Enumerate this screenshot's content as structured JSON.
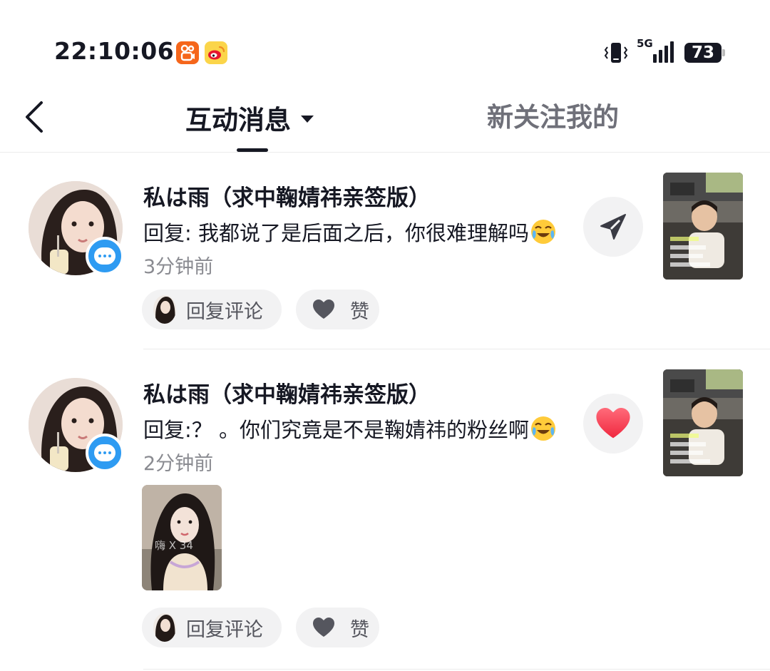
{
  "status_bar": {
    "time": "22:10:06",
    "network": "5G",
    "battery": "73",
    "app_icons": [
      "kuaishou-app-icon",
      "weibo-app-icon"
    ]
  },
  "nav": {
    "back_icon": "chevron-left-icon",
    "active_tab": "互动消息",
    "inactive_tab": "新关注我的"
  },
  "notifications": [
    {
      "username": "私は雨（求中鞠婧祎亲签版）",
      "comment": "回复: 我都说了是后面之后，你很难理解吗",
      "emoji": "crying-laughing-emoji",
      "time": "3分钟前",
      "action_icon": "send-icon",
      "reply_label": "回复评论",
      "like_label": "赞"
    },
    {
      "username": "私は雨（求中鞠婧祎亲签版）",
      "comment": "回复:？ 。你们究竟是不是鞠婧祎的粉丝啊",
      "emoji": "crying-laughing-emoji",
      "time": "2分钟前",
      "action_icon": "red-heart-icon",
      "image_overlay_text": "嗨 X 34",
      "reply_label": "回复评论",
      "like_label": "赞"
    }
  ],
  "colors": {
    "primary_text": "#161823",
    "secondary_text": "#8a8b91",
    "badge_blue": "#2e9bf2",
    "heart_red": "#fe2c55",
    "pill_bg": "#f2f2f3"
  }
}
